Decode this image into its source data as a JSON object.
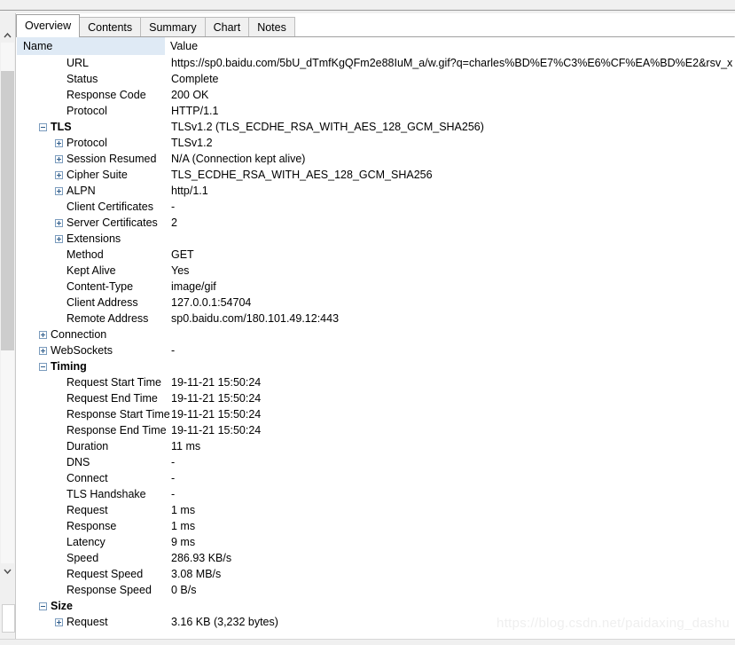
{
  "tabs": [
    {
      "label": "Overview",
      "active": true
    },
    {
      "label": "Contents",
      "active": false
    },
    {
      "label": "Summary",
      "active": false
    },
    {
      "label": "Chart",
      "active": false
    },
    {
      "label": "Notes",
      "active": false
    }
  ],
  "columns": {
    "name": "Name",
    "value": "Value"
  },
  "rows": [
    {
      "level": 1,
      "expander": "none",
      "name": "URL",
      "value": "https://sp0.baidu.com/5bU_dTmfKgQFm2e88IuM_a/w.gif?q=charles%BD%E7%C3%E6%CF%EA%BD%E2&rsv_x"
    },
    {
      "level": 1,
      "expander": "none",
      "name": "Status",
      "value": "Complete"
    },
    {
      "level": 1,
      "expander": "none",
      "name": "Response Code",
      "value": "200 OK"
    },
    {
      "level": 1,
      "expander": "none",
      "name": "Protocol",
      "value": "HTTP/1.1"
    },
    {
      "level": 0,
      "expander": "minus",
      "name": "TLS",
      "value": "TLSv1.2 (TLS_ECDHE_RSA_WITH_AES_128_GCM_SHA256)",
      "group": true
    },
    {
      "level": 2,
      "expander": "plus",
      "name": "Protocol",
      "value": "TLSv1.2"
    },
    {
      "level": 2,
      "expander": "plus",
      "name": "Session Resumed",
      "value": "N/A (Connection kept alive)"
    },
    {
      "level": 2,
      "expander": "plus",
      "name": "Cipher Suite",
      "value": "TLS_ECDHE_RSA_WITH_AES_128_GCM_SHA256"
    },
    {
      "level": 2,
      "expander": "plus",
      "name": "ALPN",
      "value": "http/1.1"
    },
    {
      "level": 2,
      "expander": "none",
      "name": "Client Certificates",
      "value": "-"
    },
    {
      "level": 2,
      "expander": "plus",
      "name": "Server Certificates",
      "value": "2"
    },
    {
      "level": 2,
      "expander": "plus",
      "name": "Extensions",
      "value": ""
    },
    {
      "level": 1,
      "expander": "none",
      "name": "Method",
      "value": "GET"
    },
    {
      "level": 1,
      "expander": "none",
      "name": "Kept Alive",
      "value": "Yes"
    },
    {
      "level": 1,
      "expander": "none",
      "name": "Content-Type",
      "value": "image/gif"
    },
    {
      "level": 1,
      "expander": "none",
      "name": "Client Address",
      "value": "127.0.0.1:54704"
    },
    {
      "level": 1,
      "expander": "none",
      "name": "Remote Address",
      "value": "sp0.baidu.com/180.101.49.12:443"
    },
    {
      "level": 0,
      "expander": "plus",
      "name": "Connection",
      "value": ""
    },
    {
      "level": 0,
      "expander": "plus",
      "name": "WebSockets",
      "value": "-"
    },
    {
      "level": 0,
      "expander": "minus",
      "name": "Timing",
      "value": "",
      "group": true
    },
    {
      "level": 1,
      "expander": "none",
      "name": "Request Start Time",
      "value": "19-11-21 15:50:24"
    },
    {
      "level": 1,
      "expander": "none",
      "name": "Request End Time",
      "value": "19-11-21 15:50:24"
    },
    {
      "level": 1,
      "expander": "none",
      "name": "Response Start Time",
      "value": "19-11-21 15:50:24"
    },
    {
      "level": 1,
      "expander": "none",
      "name": "Response End Time",
      "value": "19-11-21 15:50:24"
    },
    {
      "level": 1,
      "expander": "none",
      "name": "Duration",
      "value": "11 ms"
    },
    {
      "level": 1,
      "expander": "none",
      "name": "DNS",
      "value": "-"
    },
    {
      "level": 1,
      "expander": "none",
      "name": "Connect",
      "value": "-"
    },
    {
      "level": 1,
      "expander": "none",
      "name": "TLS Handshake",
      "value": "-"
    },
    {
      "level": 1,
      "expander": "none",
      "name": "Request",
      "value": "1 ms"
    },
    {
      "level": 1,
      "expander": "none",
      "name": "Response",
      "value": "1 ms"
    },
    {
      "level": 1,
      "expander": "none",
      "name": "Latency",
      "value": "9 ms"
    },
    {
      "level": 1,
      "expander": "none",
      "name": "Speed",
      "value": "286.93 KB/s"
    },
    {
      "level": 1,
      "expander": "none",
      "name": "Request Speed",
      "value": "3.08 MB/s"
    },
    {
      "level": 1,
      "expander": "none",
      "name": "Response Speed",
      "value": "0 B/s"
    },
    {
      "level": 0,
      "expander": "minus",
      "name": "Size",
      "value": "",
      "group": true
    },
    {
      "level": 2,
      "expander": "plus",
      "name": "Request",
      "value": "3.16 KB (3,232 bytes)"
    }
  ],
  "watermark": "https://blog.csdn.net/paidaxing_dashu",
  "scrollbar": {
    "up_icon": "chevron-up-icon",
    "down_icon": "chevron-down-icon"
  },
  "colors": {
    "header_name_bg": "#dfeaf5",
    "window_chrome": "#f0f0f0",
    "scroll_thumb": "#cdcdcd",
    "expander_border": "#7a9bbd"
  }
}
